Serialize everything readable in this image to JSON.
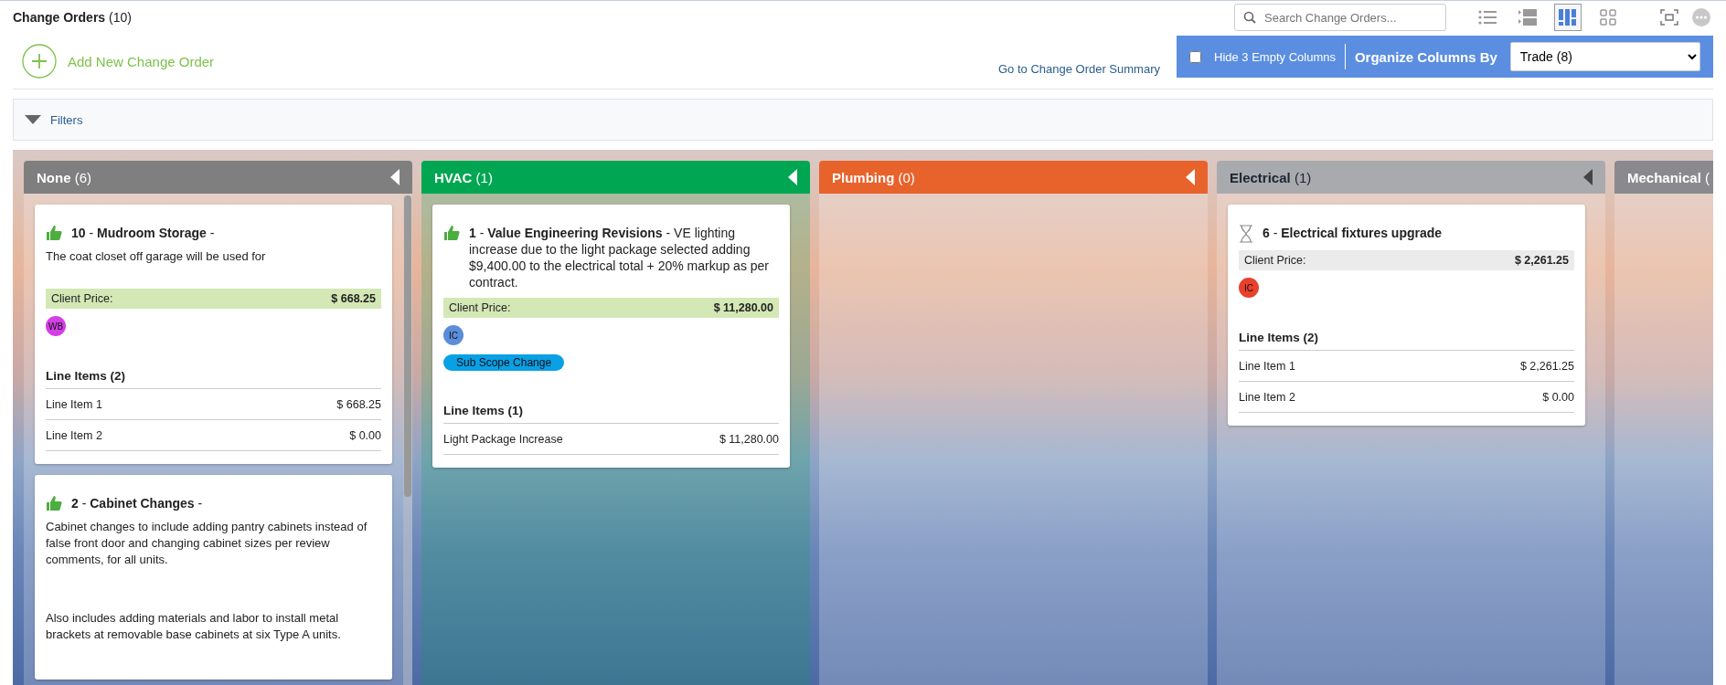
{
  "header": {
    "title": "Change Orders",
    "count": "(10)",
    "search": {
      "placeholder": "Search Change Orders..."
    },
    "view_buttons": [
      {
        "kind": "list",
        "selected": false
      },
      {
        "kind": "rows",
        "selected": false
      },
      {
        "kind": "board",
        "selected": true
      },
      {
        "kind": "grid",
        "selected": false
      }
    ]
  },
  "toolbar": {
    "add_button": "Add New Change Order",
    "summary_link": "Go to Change Order Summary",
    "hide_empty": {
      "label": "Hide 3 Empty Columns",
      "checked": false
    },
    "organize_label": "Organize Columns By",
    "organize_value": "Trade (8)"
  },
  "filters": {
    "label": "Filters",
    "expanded": false
  },
  "columns": [
    {
      "name": "None",
      "count": "(6)",
      "color": "#7f7f7f",
      "scrollbar": true,
      "cards": [
        {
          "approved": true,
          "heading": "**10** - **Mudroom Storage** -",
          "description": [
            "The coat closet off garage will be used for"
          ],
          "price_label": "Client Price:",
          "price": "$ 668.25",
          "avatar": {
            "initials": "WB",
            "color": "#d33fe6"
          },
          "line_items_title": "Line Items (2)",
          "line_items": [
            {
              "name": "Line Item 1",
              "amount": "$ 668.25"
            },
            {
              "name": "Line Item 2",
              "amount": "$ 0.00"
            }
          ]
        },
        {
          "approved": true,
          "heading": "**2** - **Cabinet Changes** -",
          "description": [
            "Cabinet changes to include adding pantry cabinets instead of false front door and changing cabinet sizes per review comments, for all units.",
            "Also includes adding materials and labor to install metal brackets at removable base cabinets at six Type A units."
          ]
        }
      ]
    },
    {
      "name": "HVAC",
      "count": "(1)",
      "color": "#00a651",
      "scrollbar": false,
      "cards": [
        {
          "approved": true,
          "heading": "**1** - **Value Engineering Revisions** - VE lighting increase due to the light package selected adding $9,400.00 to the electrical total + 20% markup as per contract.",
          "price_label": "Client Price:",
          "price": "$ 11,280.00",
          "avatar": {
            "initials": "IC",
            "color": "#5b8ddb"
          },
          "tag": "Sub Scope Change",
          "line_items_title": "Line Items (1)",
          "line_items": [
            {
              "name": "Light Package Increase",
              "amount": "$ 11,280.00"
            }
          ]
        }
      ]
    },
    {
      "name": "Plumbing",
      "count": "(0)",
      "color": "#e8622c",
      "scrollbar": false
    },
    {
      "name": "Electrical",
      "count": "(1)",
      "color": "#a9aaae",
      "scrollbar": false,
      "cards": [
        {
          "approved": false,
          "heading": "**6** - **Electrical fixtures upgrade**",
          "price_label": "Client Price:",
          "price": "$ 2,261.25",
          "avatar": {
            "initials": "IC",
            "color": "#e8412c"
          },
          "line_items_title": "Line Items (2)",
          "line_items": [
            {
              "name": "Line Item 1",
              "amount": "$ 2,261.25"
            },
            {
              "name": "Line Item 2",
              "amount": "$ 0.00"
            }
          ]
        }
      ]
    },
    {
      "name": "Mechanical",
      "count": "(",
      "color": "#8a8a8e",
      "scrollbar": false
    }
  ]
}
